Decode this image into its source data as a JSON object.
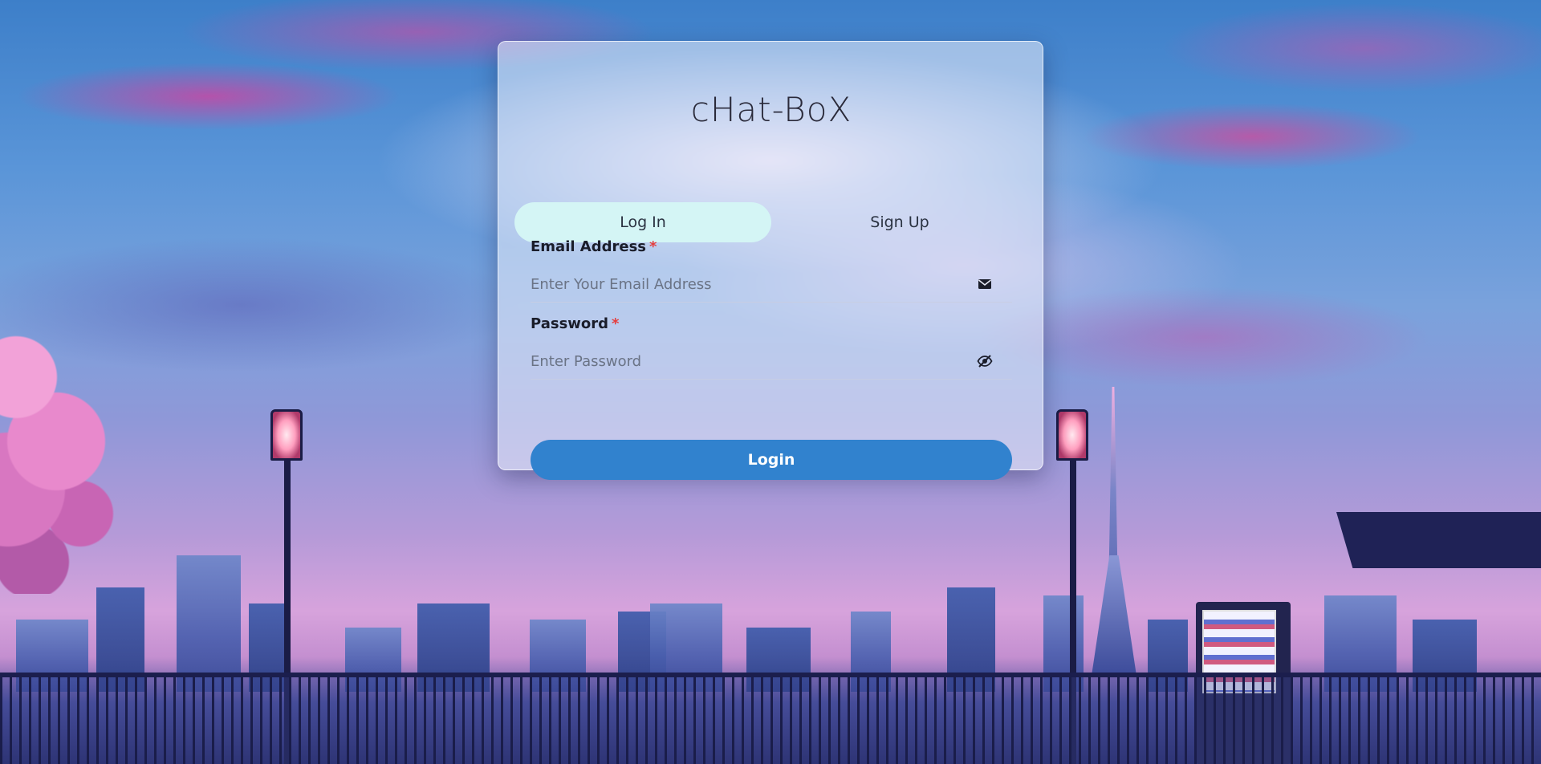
{
  "app": {
    "title": "cHat-BoX"
  },
  "tabs": [
    {
      "label": "Log In",
      "active": true
    },
    {
      "label": "Sign Up",
      "active": false
    }
  ],
  "form": {
    "email": {
      "label": "Email Address",
      "required_mark": "*",
      "placeholder": "Enter Your Email Address",
      "value": "",
      "icon": "envelope-icon"
    },
    "password": {
      "label": "Password",
      "required_mark": "*",
      "placeholder": "Enter Password",
      "value": "",
      "icon": "eye-slash-icon"
    },
    "submit_label": "Login"
  },
  "colors": {
    "active_tab": "#d4f5f5",
    "primary_button": "#3182ce",
    "required": "#e53e3e"
  }
}
